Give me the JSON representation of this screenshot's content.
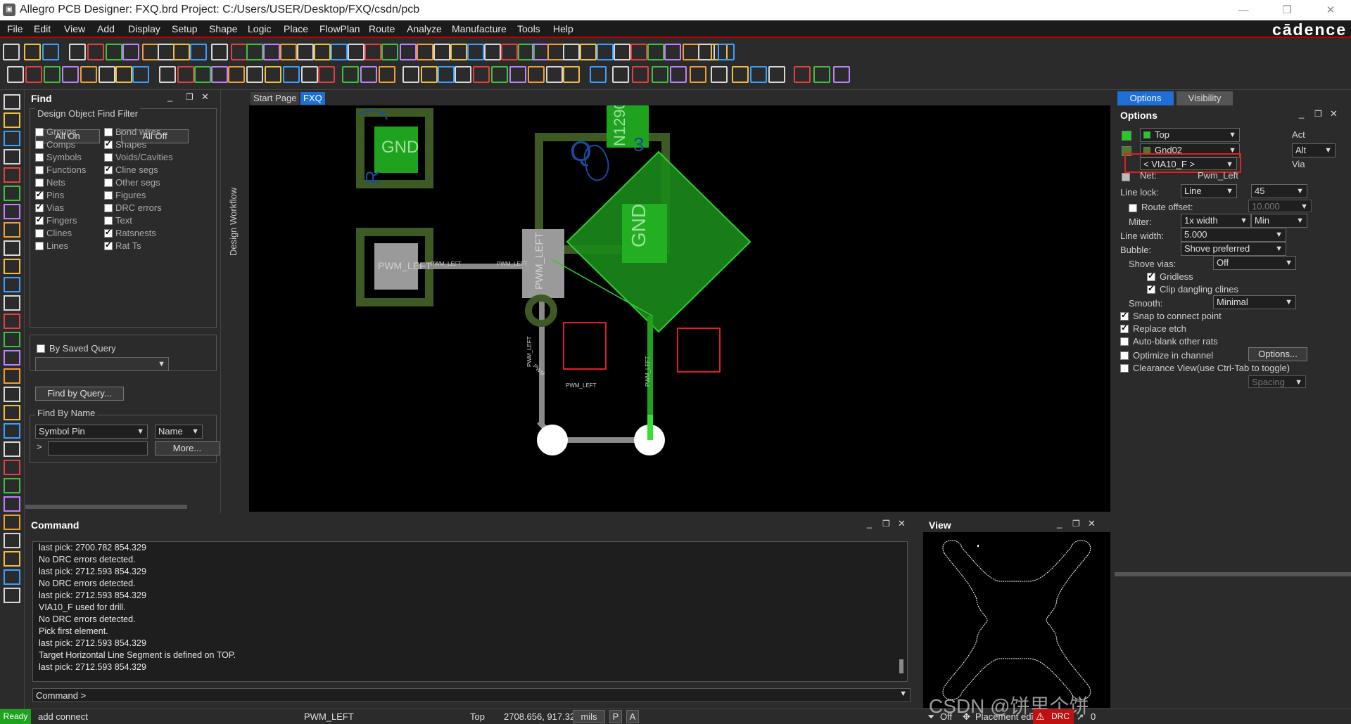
{
  "window": {
    "title": "Allegro PCB Designer: FXQ.brd  Project: C:/Users/USER/Desktop/FXQ/csdn/pcb"
  },
  "menu": [
    "File",
    "Edit",
    "View",
    "Add",
    "Display",
    "Setup",
    "Shape",
    "Logic",
    "Place",
    "FlowPlan",
    "Route",
    "Analyze",
    "Manufacture",
    "Tools",
    "Help"
  ],
  "brand": "cādence",
  "tabs": [
    "Start Page",
    "FXQ"
  ],
  "workflow_label": "Design Workflow",
  "find": {
    "title": "Find",
    "filter_title": "Design Object Find Filter",
    "all_on": "All On",
    "all_off": "All Off",
    "left_items": [
      {
        "label": "Groups",
        "checked": false
      },
      {
        "label": "Comps",
        "checked": false
      },
      {
        "label": "Symbols",
        "checked": false
      },
      {
        "label": "Functions",
        "checked": false
      },
      {
        "label": "Nets",
        "checked": false
      },
      {
        "label": "Pins",
        "checked": true
      },
      {
        "label": "Vias",
        "checked": true
      },
      {
        "label": "Fingers",
        "checked": true
      },
      {
        "label": "Clines",
        "checked": false
      },
      {
        "label": "Lines",
        "checked": false
      }
    ],
    "right_items": [
      {
        "label": "Bond wires",
        "checked": false
      },
      {
        "label": "Shapes",
        "checked": true
      },
      {
        "label": "Voids/Cavities",
        "checked": false
      },
      {
        "label": "Cline segs",
        "checked": true
      },
      {
        "label": "Other segs",
        "checked": false
      },
      {
        "label": "Figures",
        "checked": false
      },
      {
        "label": "DRC errors",
        "checked": false
      },
      {
        "label": "Text",
        "checked": false
      },
      {
        "label": "Ratsnests",
        "checked": true
      },
      {
        "label": "Rat Ts",
        "checked": true
      }
    ],
    "by_saved_query": "By Saved Query",
    "find_by_query": "Find by Query...",
    "find_by_name": "Find By Name",
    "name_type": "Symbol Pin",
    "name_mode": "Name",
    "name_prefix": ">",
    "more": "More..."
  },
  "canvas": {
    "gnd_left": "GND",
    "gnd_right": "GND",
    "pad_left_label": "PWM_LEFT",
    "trace_label_1": "PWM_LEFT",
    "trace_label_2": "PWM_LEFT",
    "pad_mid_label": "PWM_LEFT",
    "vertical_label_1": "PWM_LEFT",
    "vertical_label_2": "PWM_LEFT",
    "bottom_label": "PWM_LEFT",
    "right_vertical_label": "PWM_LEFT",
    "comp_label": "N1290",
    "small_label": "PWM",
    "letter_r": "R",
    "letter_q": "Q",
    "digit_3": "3"
  },
  "command": {
    "title": "Command",
    "lines": [
      "last pick:  2700.782 854.329",
      "No DRC errors detected.",
      "last pick:  2712.593 854.329",
      "No DRC errors detected.",
      "last pick:  2712.593 854.329",
      "VIA10_F used for drill.",
      "No DRC errors detected.",
      "Pick first element.",
      "last pick:  2712.593 854.329",
      "Target Horizontal Line Segment is defined on TOP.",
      "last pick:  2712.593 854.329"
    ],
    "prompt": "Command >"
  },
  "view": {
    "title": "View"
  },
  "options": {
    "tab_options": "Options",
    "tab_visibility": "Visibility",
    "title": "Options",
    "layer1": "Top",
    "layer2": "Gnd02",
    "via": "< VIA10_F >",
    "act": "Act",
    "alt": "Alt",
    "via_label": "Via",
    "net_label": "Net:",
    "net_value": "Pwm_Left",
    "line_lock_label": "Line lock:",
    "line_lock": "Line",
    "line_lock_angle": "45",
    "route_offset_label": "Route offset:",
    "route_offset": "10.000",
    "miter_label": "Miter:",
    "miter": "1x width",
    "miter_min": "Min",
    "line_width_label": "Line width:",
    "line_width": "5.000",
    "bubble_label": "Bubble:",
    "bubble": "Shove preferred",
    "shove_vias_label": "Shove vias:",
    "shove_vias": "Off",
    "gridless": "Gridless",
    "clip_dangling": "Clip dangling clines",
    "smooth_label": "Smooth:",
    "smooth": "Minimal",
    "snap": "Snap to connect point",
    "replace_etch": "Replace etch",
    "auto_blank": "Auto-blank other rats",
    "optimize": "Optimize in channel",
    "options_btn": "Options...",
    "clearance": "Clearance View(use Ctrl-Tab to toggle)",
    "spacing": "Spacing",
    "colors": {
      "top": "#22cc22",
      "gnd02": "#4a7a2a"
    }
  },
  "status": {
    "ready": "Ready",
    "command": "add connect",
    "net": "PWM_LEFT",
    "layer": "Top",
    "coords": "2708.656, 917.321",
    "units": "mils",
    "p": "P",
    "a": "A",
    "off": "Off",
    "placement": "Placement edit",
    "drc": "DRC",
    "count": "0",
    "watermark": "CSDN @饼里个饼"
  }
}
